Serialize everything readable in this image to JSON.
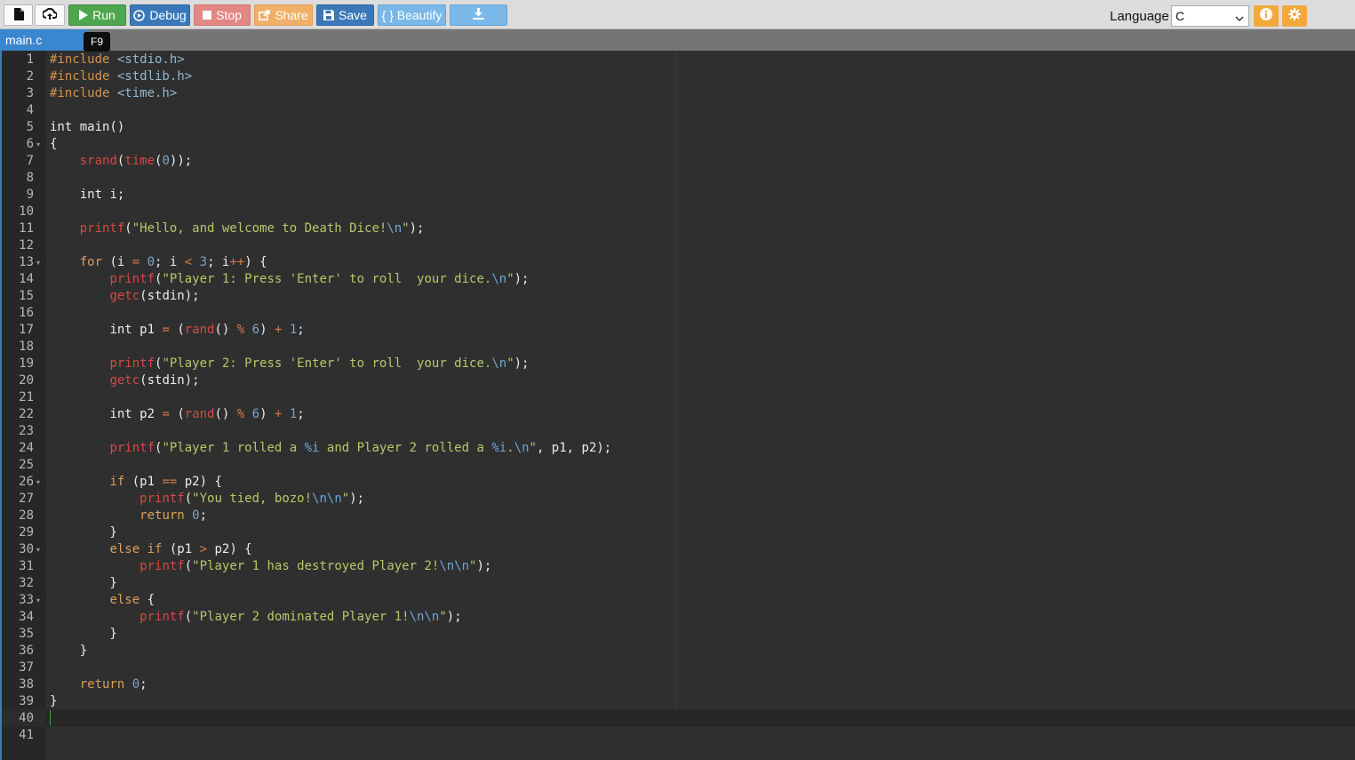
{
  "toolbar": {
    "run_label": "Run",
    "debug_label": "Debug",
    "stop_label": "Stop",
    "share_label": "Share",
    "save_label": "Save",
    "beautify_label": "{ } Beautify",
    "language_label": "Language",
    "language_value": "C"
  },
  "tabs": {
    "active_file": "main.c",
    "tooltip": "F9"
  },
  "editor": {
    "active_line": 40,
    "lines": [
      {
        "n": 1,
        "fold": false,
        "tokens": [
          [
            "pp",
            "#include "
          ],
          [
            "inc",
            "<stdio.h>"
          ]
        ]
      },
      {
        "n": 2,
        "fold": false,
        "tokens": [
          [
            "pp",
            "#include "
          ],
          [
            "inc",
            "<stdlib.h>"
          ]
        ]
      },
      {
        "n": 3,
        "fold": false,
        "tokens": [
          [
            "pp",
            "#include "
          ],
          [
            "inc",
            "<time.h>"
          ]
        ]
      },
      {
        "n": 4,
        "fold": false,
        "tokens": []
      },
      {
        "n": 5,
        "fold": false,
        "tokens": [
          [
            "ty",
            "int "
          ],
          [
            "pl",
            "main()"
          ]
        ]
      },
      {
        "n": 6,
        "fold": true,
        "tokens": [
          [
            "pl",
            "{"
          ]
        ]
      },
      {
        "n": 7,
        "fold": false,
        "tokens": [
          [
            "pl",
            "    "
          ],
          [
            "fn",
            "srand"
          ],
          [
            "pl",
            "("
          ],
          [
            "fn",
            "time"
          ],
          [
            "pl",
            "("
          ],
          [
            "num",
            "0"
          ],
          [
            "pl",
            "));"
          ]
        ]
      },
      {
        "n": 8,
        "fold": false,
        "tokens": []
      },
      {
        "n": 9,
        "fold": false,
        "tokens": [
          [
            "pl",
            "    "
          ],
          [
            "ty",
            "int "
          ],
          [
            "pl",
            "i;"
          ]
        ]
      },
      {
        "n": 10,
        "fold": false,
        "tokens": []
      },
      {
        "n": 11,
        "fold": false,
        "tokens": [
          [
            "pl",
            "    "
          ],
          [
            "fn",
            "printf"
          ],
          [
            "pl",
            "("
          ],
          [
            "str",
            "\"Hello, and welcome to Death Dice!"
          ],
          [
            "esc",
            "\\n"
          ],
          [
            "str",
            "\""
          ],
          [
            "pl",
            ");"
          ]
        ]
      },
      {
        "n": 12,
        "fold": false,
        "tokens": []
      },
      {
        "n": 13,
        "fold": true,
        "tokens": [
          [
            "pl",
            "    "
          ],
          [
            "kw",
            "for "
          ],
          [
            "pl",
            "(i "
          ],
          [
            "op",
            "="
          ],
          [
            "pl",
            " "
          ],
          [
            "num",
            "0"
          ],
          [
            "pl",
            "; i "
          ],
          [
            "op",
            "<"
          ],
          [
            "pl",
            " "
          ],
          [
            "num",
            "3"
          ],
          [
            "pl",
            "; i"
          ],
          [
            "op",
            "++"
          ],
          [
            "pl",
            ") {"
          ]
        ]
      },
      {
        "n": 14,
        "fold": false,
        "tokens": [
          [
            "pl",
            "        "
          ],
          [
            "fn",
            "printf"
          ],
          [
            "pl",
            "("
          ],
          [
            "str",
            "\"Player 1: Press 'Enter' to roll  your dice."
          ],
          [
            "esc",
            "\\n"
          ],
          [
            "str",
            "\""
          ],
          [
            "pl",
            ");"
          ]
        ]
      },
      {
        "n": 15,
        "fold": false,
        "tokens": [
          [
            "pl",
            "        "
          ],
          [
            "fn",
            "getc"
          ],
          [
            "pl",
            "(stdin);"
          ]
        ]
      },
      {
        "n": 16,
        "fold": false,
        "tokens": []
      },
      {
        "n": 17,
        "fold": false,
        "tokens": [
          [
            "pl",
            "        "
          ],
          [
            "ty",
            "int "
          ],
          [
            "pl",
            "p1 "
          ],
          [
            "op",
            "="
          ],
          [
            "pl",
            " ("
          ],
          [
            "fn",
            "rand"
          ],
          [
            "pl",
            "() "
          ],
          [
            "op",
            "%"
          ],
          [
            "pl",
            " "
          ],
          [
            "num",
            "6"
          ],
          [
            "pl",
            ") "
          ],
          [
            "op",
            "+"
          ],
          [
            "pl",
            " "
          ],
          [
            "num",
            "1"
          ],
          [
            "pl",
            ";"
          ]
        ]
      },
      {
        "n": 18,
        "fold": false,
        "tokens": []
      },
      {
        "n": 19,
        "fold": false,
        "tokens": [
          [
            "pl",
            "        "
          ],
          [
            "fn",
            "printf"
          ],
          [
            "pl",
            "("
          ],
          [
            "str",
            "\"Player 2: Press 'Enter' to roll  your dice."
          ],
          [
            "esc",
            "\\n"
          ],
          [
            "str",
            "\""
          ],
          [
            "pl",
            ");"
          ]
        ]
      },
      {
        "n": 20,
        "fold": false,
        "tokens": [
          [
            "pl",
            "        "
          ],
          [
            "fn",
            "getc"
          ],
          [
            "pl",
            "(stdin);"
          ]
        ]
      },
      {
        "n": 21,
        "fold": false,
        "tokens": []
      },
      {
        "n": 22,
        "fold": false,
        "tokens": [
          [
            "pl",
            "        "
          ],
          [
            "ty",
            "int "
          ],
          [
            "pl",
            "p2 "
          ],
          [
            "op",
            "="
          ],
          [
            "pl",
            " ("
          ],
          [
            "fn",
            "rand"
          ],
          [
            "pl",
            "() "
          ],
          [
            "op",
            "%"
          ],
          [
            "pl",
            " "
          ],
          [
            "num",
            "6"
          ],
          [
            "pl",
            ") "
          ],
          [
            "op",
            "+"
          ],
          [
            "pl",
            " "
          ],
          [
            "num",
            "1"
          ],
          [
            "pl",
            ";"
          ]
        ]
      },
      {
        "n": 23,
        "fold": false,
        "tokens": []
      },
      {
        "n": 24,
        "fold": false,
        "tokens": [
          [
            "pl",
            "        "
          ],
          [
            "fn",
            "printf"
          ],
          [
            "pl",
            "("
          ],
          [
            "str",
            "\"Player 1 rolled a "
          ],
          [
            "esc",
            "%i"
          ],
          [
            "str",
            " and Player 2 rolled a "
          ],
          [
            "esc",
            "%i"
          ],
          [
            "str",
            "."
          ],
          [
            "esc",
            "\\n"
          ],
          [
            "str",
            "\""
          ],
          [
            "pl",
            ", p1, p2);"
          ]
        ]
      },
      {
        "n": 25,
        "fold": false,
        "tokens": []
      },
      {
        "n": 26,
        "fold": true,
        "tokens": [
          [
            "pl",
            "        "
          ],
          [
            "kw",
            "if "
          ],
          [
            "pl",
            "(p1 "
          ],
          [
            "op",
            "=="
          ],
          [
            "pl",
            " p2) {"
          ]
        ]
      },
      {
        "n": 27,
        "fold": false,
        "tokens": [
          [
            "pl",
            "            "
          ],
          [
            "fn",
            "printf"
          ],
          [
            "pl",
            "("
          ],
          [
            "str",
            "\"You tied, bozo!"
          ],
          [
            "esc",
            "\\n\\n"
          ],
          [
            "str",
            "\""
          ],
          [
            "pl",
            ");"
          ]
        ]
      },
      {
        "n": 28,
        "fold": false,
        "tokens": [
          [
            "pl",
            "            "
          ],
          [
            "kw",
            "return "
          ],
          [
            "num",
            "0"
          ],
          [
            "pl",
            ";"
          ]
        ]
      },
      {
        "n": 29,
        "fold": false,
        "tokens": [
          [
            "pl",
            "        }"
          ]
        ]
      },
      {
        "n": 30,
        "fold": true,
        "tokens": [
          [
            "pl",
            "        "
          ],
          [
            "kw",
            "else if "
          ],
          [
            "pl",
            "(p1 "
          ],
          [
            "op",
            ">"
          ],
          [
            "pl",
            " p2) {"
          ]
        ]
      },
      {
        "n": 31,
        "fold": false,
        "tokens": [
          [
            "pl",
            "            "
          ],
          [
            "fn",
            "printf"
          ],
          [
            "pl",
            "("
          ],
          [
            "str",
            "\"Player 1 has destroyed Player 2!"
          ],
          [
            "esc",
            "\\n\\n"
          ],
          [
            "str",
            "\""
          ],
          [
            "pl",
            ");"
          ]
        ]
      },
      {
        "n": 32,
        "fold": false,
        "tokens": [
          [
            "pl",
            "        }"
          ]
        ]
      },
      {
        "n": 33,
        "fold": true,
        "tokens": [
          [
            "pl",
            "        "
          ],
          [
            "kw",
            "else "
          ],
          [
            "pl",
            "{"
          ]
        ]
      },
      {
        "n": 34,
        "fold": false,
        "tokens": [
          [
            "pl",
            "            "
          ],
          [
            "fn",
            "printf"
          ],
          [
            "pl",
            "("
          ],
          [
            "str",
            "\"Player 2 dominated Player 1!"
          ],
          [
            "esc",
            "\\n\\n"
          ],
          [
            "str",
            "\""
          ],
          [
            "pl",
            ");"
          ]
        ]
      },
      {
        "n": 35,
        "fold": false,
        "tokens": [
          [
            "pl",
            "        }"
          ]
        ]
      },
      {
        "n": 36,
        "fold": false,
        "tokens": [
          [
            "pl",
            "    }"
          ]
        ]
      },
      {
        "n": 37,
        "fold": false,
        "tokens": []
      },
      {
        "n": 38,
        "fold": false,
        "tokens": [
          [
            "pl",
            "    "
          ],
          [
            "kw",
            "return "
          ],
          [
            "num",
            "0"
          ],
          [
            "pl",
            ";"
          ]
        ]
      },
      {
        "n": 39,
        "fold": false,
        "tokens": [
          [
            "pl",
            "}"
          ]
        ]
      },
      {
        "n": 40,
        "fold": false,
        "tokens": []
      },
      {
        "n": 41,
        "fold": false,
        "tokens": []
      }
    ]
  }
}
